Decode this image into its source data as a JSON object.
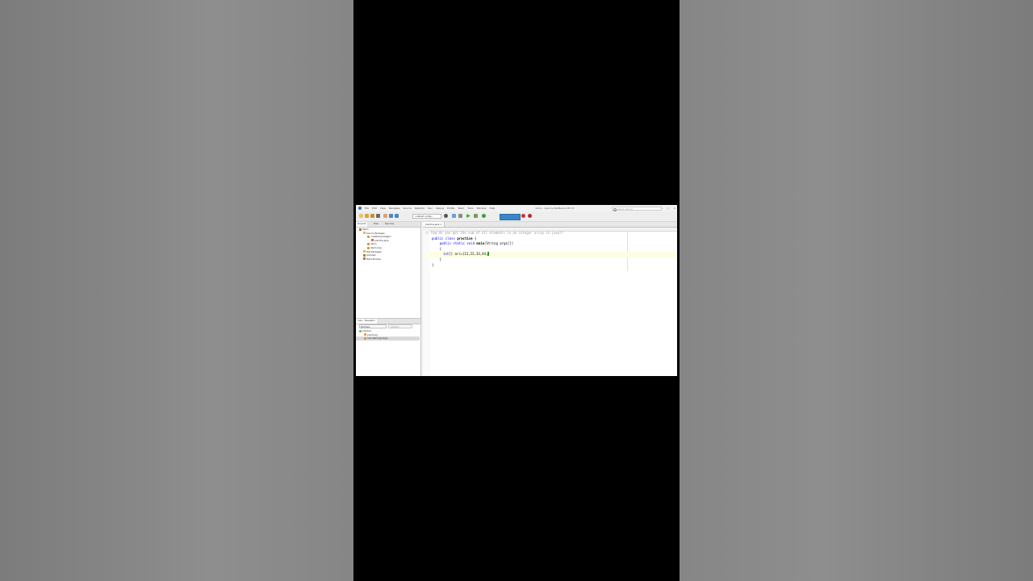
{
  "window": {
    "title": "demo - Apache NetBeans IDE 21",
    "search_placeholder": "Search (Ctrl+I)",
    "controls": [
      "–",
      "□",
      "×"
    ]
  },
  "menu": [
    "File",
    "Edit",
    "View",
    "Navigate",
    "Source",
    "Refactor",
    "Run",
    "Debug",
    "Profile",
    "Team",
    "Tools",
    "Window",
    "Help"
  ],
  "toolbar": {
    "config_select": "<default config>"
  },
  "projects_panel": {
    "tabs": [
      "Projects",
      "Files",
      "Services"
    ],
    "tree": [
      {
        "label": "demo",
        "icon": "project-icon",
        "indent": 0
      },
      {
        "label": "Source Packages",
        "icon": "folder-icon",
        "indent": 1
      },
      {
        "label": "<default package>",
        "icon": "package-icon",
        "indent": 2
      },
      {
        "label": "practice.java",
        "icon": "java-file-icon",
        "indent": 3
      },
      {
        "label": "demo",
        "icon": "package-icon",
        "indent": 2
      },
      {
        "label": "demo.img",
        "icon": "package-icon",
        "indent": 2
      },
      {
        "label": "Test Packages",
        "icon": "folder-icon",
        "indent": 1
      },
      {
        "label": "Libraries",
        "icon": "library-icon",
        "indent": 1
      },
      {
        "label": "Test Libraries",
        "icon": "library-icon",
        "indent": 1
      }
    ]
  },
  "navigator": {
    "title": "main - Navigator",
    "filter_label": "Members",
    "filter_placeholder": "<empty>",
    "items": [
      {
        "label": "practice",
        "icon": "class-icon",
        "indent": 0
      },
      {
        "label": "practice()",
        "icon": "method-icon",
        "indent": 1
      },
      {
        "label": "main(String[] args)",
        "icon": "method-icon",
        "indent": 1
      }
    ]
  },
  "editor": {
    "tab": "practice.java",
    "lines": {
      "l1": "// how do you get the sum of all elements in an integer array in java??",
      "l2_kw": "public class ",
      "l2_name": "practice",
      "l2_rest": " {",
      "l3_kw": "    public static void ",
      "l3_name": "main",
      "l3_rest": "(String args[])",
      "l4": "    {",
      "l5_kw": "int",
      "l5_rest": "[] arr={11,22,33,44,",
      "l6": "    }",
      "l7": "}"
    }
  }
}
